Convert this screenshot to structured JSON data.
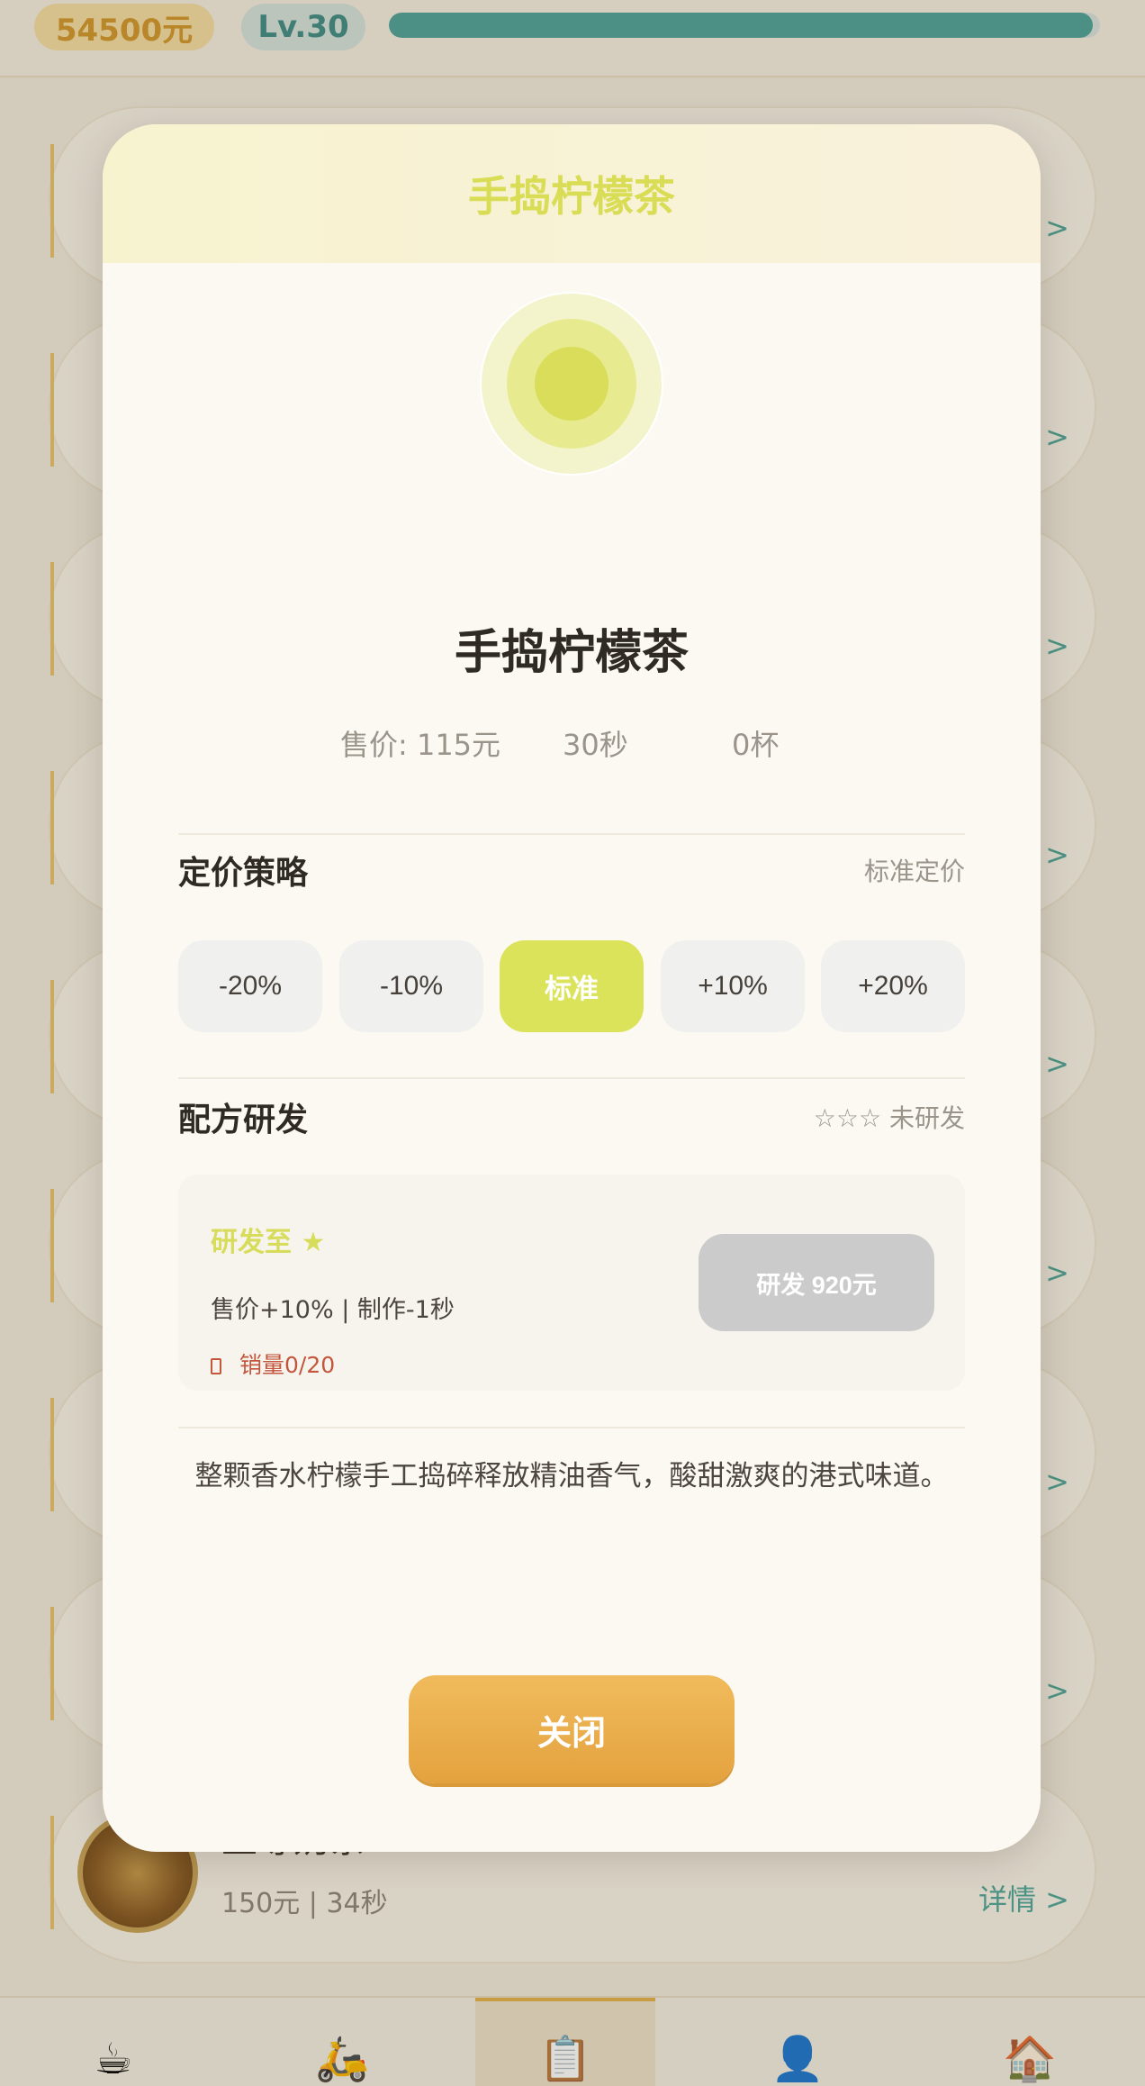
{
  "topbar": {
    "money": "54500元",
    "level": "Lv.30",
    "progress": 0.99
  },
  "background_list": {
    "last_item": {
      "title": "至尊奶茶",
      "sub": "150元 | 34秒",
      "detail": "详情 >"
    },
    "detail_label": "详情 >"
  },
  "bottom_nav": {
    "items": [
      "cup-icon",
      "scooter-icon",
      "clipboard-icon",
      "person-icon",
      "house-icon"
    ],
    "active_index": 2
  },
  "modal": {
    "header_title": "手捣柠檬茶",
    "drink_name": "手捣柠檬茶",
    "stats": {
      "price": "售价: 115元",
      "time": "30秒",
      "cups": "0杯"
    },
    "pricing": {
      "title": "定价策略",
      "current": "标准定价",
      "options": [
        "-20%",
        "-10%",
        "标准",
        "+10%",
        "+20%"
      ],
      "selected_index": 2
    },
    "research": {
      "title": "配方研发",
      "status": "☆☆☆ 未研发",
      "target_label": "研发至 ★",
      "effect": "售价+10% | 制作-1秒",
      "sales": "销量0/20",
      "button": "研发 920元"
    },
    "description": "整颗香水柠檬手工捣碎释放精油香气，酸甜激爽的港式味道。",
    "close_label": "关闭"
  },
  "colors": {
    "accent_lime": "#dbe35b",
    "close_orange": "#e9ab47",
    "teal": "#4da39a",
    "gold": "#d2962a"
  }
}
